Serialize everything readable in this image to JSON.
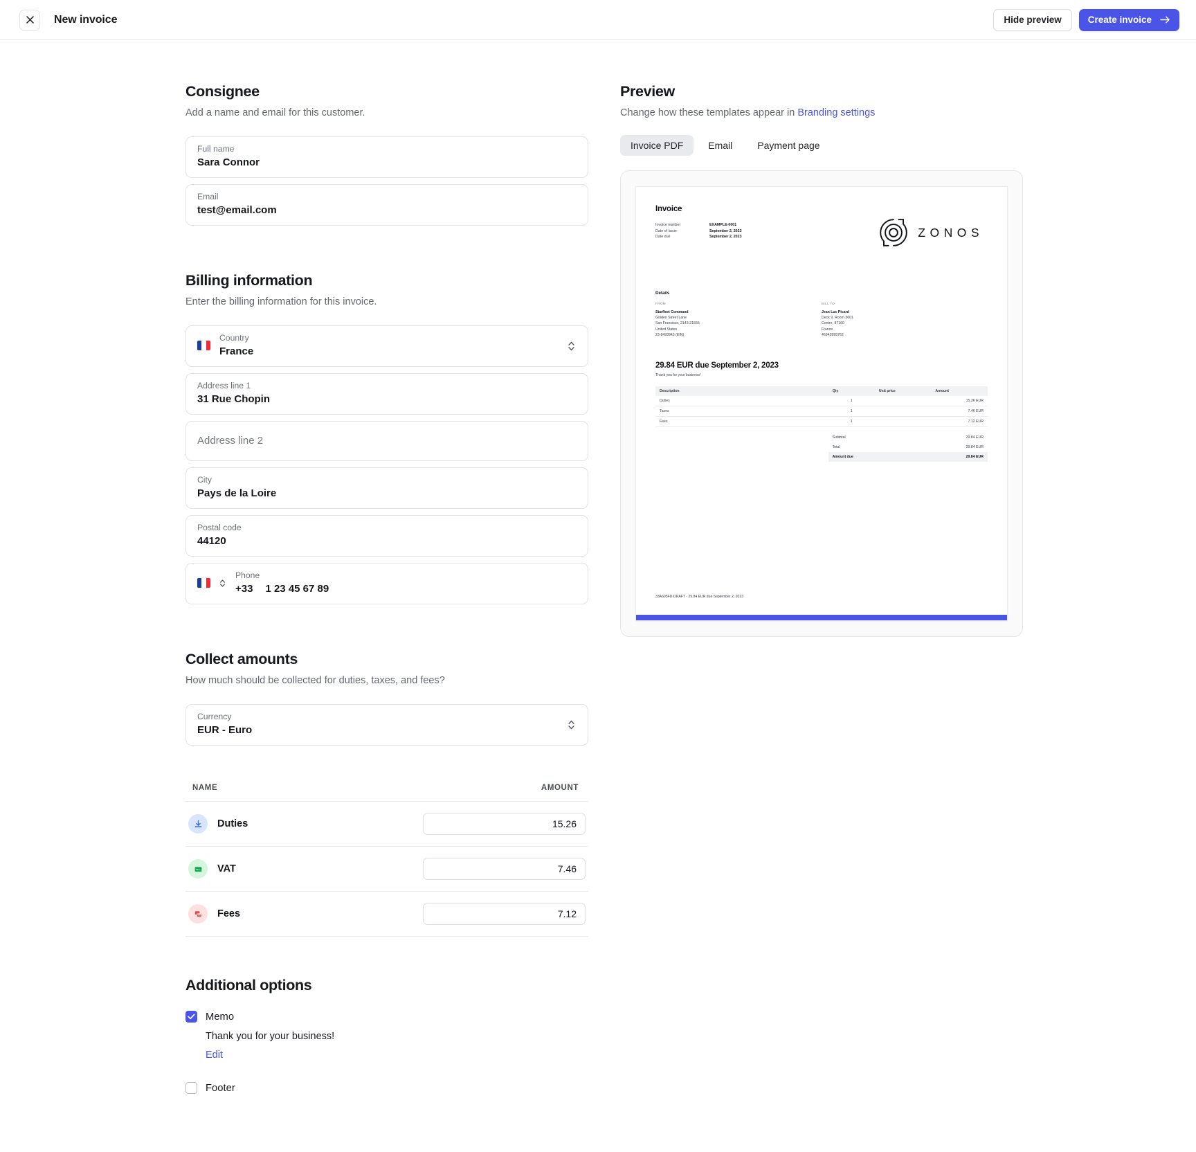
{
  "topbar": {
    "close_icon": "close-icon",
    "title": "New invoice",
    "hide_preview_label": "Hide preview",
    "create_invoice_label": "Create invoice",
    "arrow_icon": "arrow-right-icon"
  },
  "colors": {
    "accent": "#4a55e8",
    "link": "#4a55e8",
    "border": "#e2e3e7",
    "muted_text": "#63676f"
  },
  "consignee": {
    "title": "Consignee",
    "subtitle": "Add a name and email for this customer.",
    "fields": [
      {
        "label": "Full name",
        "value": "Sara Connor"
      },
      {
        "label": "Email",
        "value": "test@email.com"
      }
    ]
  },
  "billing": {
    "title": "Billing information",
    "subtitle": "Enter the billing information for this invoice.",
    "country": {
      "label": "Country",
      "value": "France",
      "flag": "fr-flag-icon"
    },
    "address1": {
      "label": "Address line 1",
      "value": "31 Rue Chopin"
    },
    "address2": {
      "label": "Address line 2",
      "placeholder": "Address line 2",
      "value": ""
    },
    "city": {
      "label": "City",
      "value": "Pays de la Loire"
    },
    "postal": {
      "label": "Postal code",
      "value": "44120"
    },
    "phone": {
      "label": "Phone",
      "dial_code": "+33",
      "value": "1 23 45 67 89",
      "flag": "fr-flag-icon"
    }
  },
  "collect": {
    "title": "Collect amounts",
    "subtitle": "How much should be collected for duties, taxes, and fees?",
    "currency": {
      "label": "Currency",
      "value": "EUR - Euro"
    },
    "table": {
      "headers": [
        "NAME",
        "AMOUNT"
      ],
      "rows": [
        {
          "name": "Duties",
          "amount": "15.26",
          "icon": "duties-download-icon",
          "icon_bg": "#d9e5fd",
          "icon_fg": "#3b6fe0"
        },
        {
          "name": "VAT",
          "amount": "7.46",
          "icon": "vat-card-icon",
          "icon_bg": "#d4f6dd",
          "icon_fg": "#18a957"
        },
        {
          "name": "Fees",
          "amount": "7.12",
          "icon": "fees-stack-icon",
          "icon_bg": "#fde0e0",
          "icon_fg": "#e04c4c"
        }
      ]
    }
  },
  "additional": {
    "title": "Additional options",
    "memo": {
      "label": "Memo",
      "checked": true,
      "text": "Thank you for your business!",
      "edit_label": "Edit"
    },
    "footer": {
      "label": "Footer",
      "checked": false
    }
  },
  "preview": {
    "title": "Preview",
    "subtitle_prefix": "Change how these templates appear in ",
    "subtitle_link": "Branding settings",
    "tabs": [
      {
        "label": "Invoice PDF",
        "active": true
      },
      {
        "label": "Email",
        "active": false
      },
      {
        "label": "Payment page",
        "active": false
      }
    ],
    "document": {
      "title": "Invoice",
      "meta": [
        {
          "key": "Invoice number",
          "value": "EXAMPLE-0001"
        },
        {
          "key": "Date of issue",
          "value": "September 2, 2023"
        },
        {
          "key": "Date due",
          "value": "September 2, 2023"
        }
      ],
      "brand_name": "ZONOS",
      "brand_mark": "zonos-logo-icon",
      "details_title": "Details",
      "from": {
        "eyebrow": "FROM",
        "name": "Starfleet Command",
        "lines": [
          "Golden Street Lane",
          "San Fransisco, 2143-21555",
          "United States",
          "23-8493943 (EIN)"
        ]
      },
      "bill_to": {
        "eyebrow": "BILL TO",
        "name": "Jean Luc Picard",
        "lines": [
          "Deck 9, Room 3601",
          "Centre, 87160",
          "France",
          "46942895762"
        ]
      },
      "due_headline": "29.84 EUR due September 2, 2023",
      "memo": "Thank you for your business!",
      "table": {
        "headers": [
          "Description",
          "Qty",
          "Unit price",
          "Amount"
        ],
        "rows": [
          {
            "description": "Duties",
            "qty": "1",
            "unit_price": "",
            "amount": "15.26 EUR"
          },
          {
            "description": "Taxes",
            "qty": "1",
            "unit_price": "",
            "amount": "7.46 EUR"
          },
          {
            "description": "Fees",
            "qty": "1",
            "unit_price": "",
            "amount": "7.12 EUR"
          }
        ]
      },
      "totals": [
        {
          "label": "Subtotal",
          "value": "29.84 EUR",
          "strong": false
        },
        {
          "label": "Total",
          "value": "29.84 EUR",
          "strong": false
        },
        {
          "label": "Amount due",
          "value": "29.84 EUR",
          "strong": true
        }
      ],
      "footer": "33A605FD-DRAFT - 29.84 EUR due September 2, 2023"
    }
  }
}
